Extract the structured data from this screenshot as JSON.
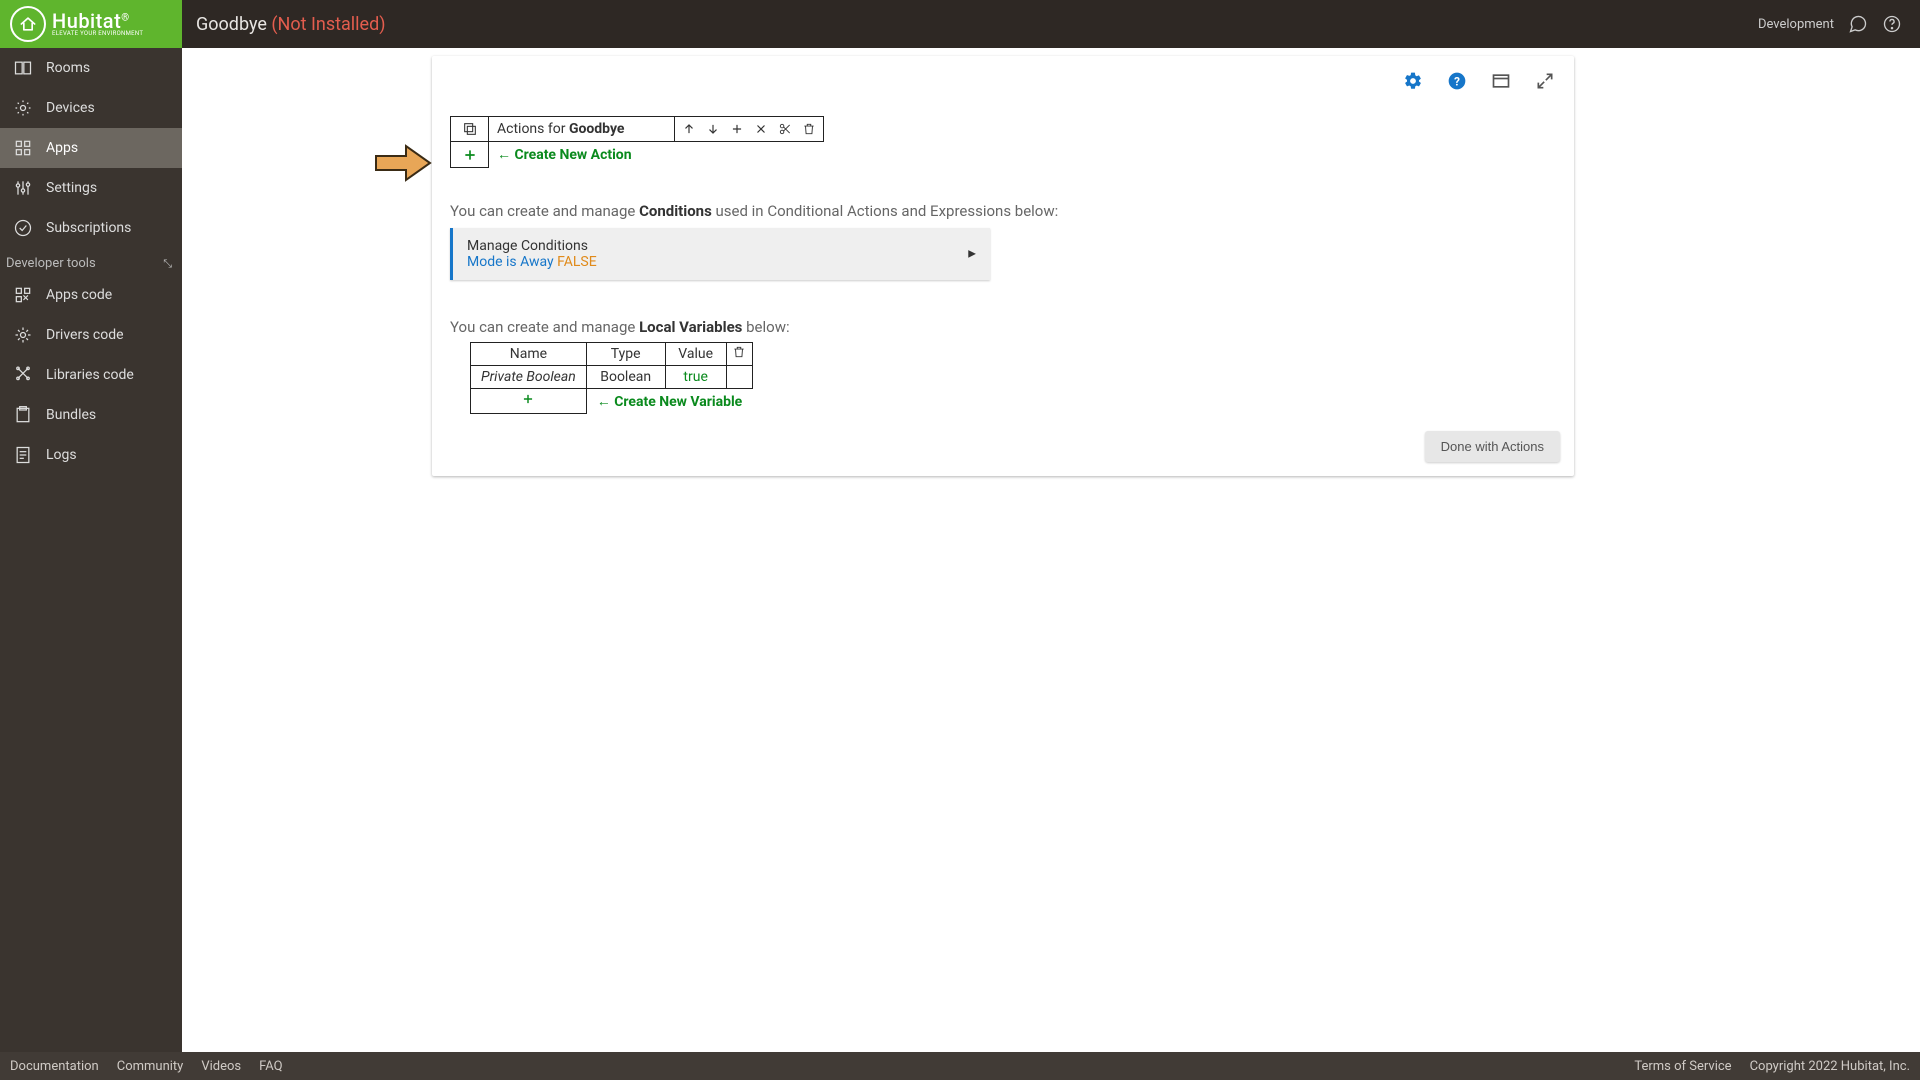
{
  "header": {
    "app_title": "Goodbye",
    "status": "(Not Installed)",
    "right_label": "Development"
  },
  "sidebar": {
    "main_items": [
      {
        "label": "Rooms"
      },
      {
        "label": "Devices"
      },
      {
        "label": "Apps"
      },
      {
        "label": "Settings"
      },
      {
        "label": "Subscriptions"
      }
    ],
    "dev_header": "Developer tools",
    "dev_items": [
      {
        "label": "Apps code"
      },
      {
        "label": "Drivers code"
      },
      {
        "label": "Libraries code"
      },
      {
        "label": "Bundles"
      },
      {
        "label": "Logs"
      }
    ]
  },
  "content": {
    "actions_header_prefix": "Actions for ",
    "actions_header_name": "Goodbye",
    "create_action_label": "← Create New Action",
    "conditions_text_pre": "You can create and manage ",
    "conditions_text_bold": "Conditions",
    "conditions_text_post": " used in Conditional Actions and Expressions below:",
    "manage_title": "Manage Conditions",
    "condition_text": "Mode is Away",
    "condition_state": "FALSE",
    "locals_text_pre": "You can create and manage ",
    "locals_text_bold": "Local Variables",
    "locals_text_post": " below:",
    "vars_headers": {
      "name": "Name",
      "type": "Type",
      "value": "Value"
    },
    "vars_row": {
      "name": "Private Boolean",
      "type": "Boolean",
      "value": "true"
    },
    "create_variable_label": "← Create New Variable",
    "done_label": "Done with Actions"
  },
  "footer": {
    "links": [
      "Documentation",
      "Community",
      "Videos",
      "FAQ"
    ],
    "right": [
      "Terms of Service",
      "Copyright 2022 Hubitat, Inc."
    ]
  }
}
